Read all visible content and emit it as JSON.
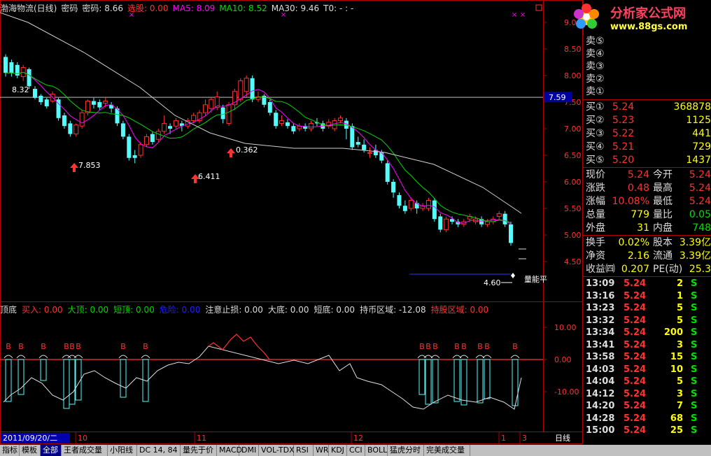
{
  "header": {
    "title": "渤海物流(日线)",
    "pwd_label": "密码",
    "pwd2": "密码: 8.66",
    "xuangu": "选股: 0.00",
    "ma5": "MA5: 8.09",
    "ma10": "MA10: 8.52",
    "ma30": "MA30: 9.46",
    "t0": "T0: - : -"
  },
  "price_axis": [
    "9.00",
    "8.50",
    "8.00",
    "7.50",
    "7.00",
    "6.50",
    "6.00",
    "5.50",
    "5.00",
    "4.50"
  ],
  "current_line_label": "7.59",
  "annotations": {
    "low_label_1": "7.853",
    "low_label_2": "6.411",
    "low_label_3": "0.362",
    "start_label": "8.32",
    "min_label": "4.60",
    "right_label": "量能平"
  },
  "indicator": {
    "name": "顶底",
    "buy": "买入: 0.00",
    "big_top": "大顶: 0.00",
    "short_top": "短顶: 0.00",
    "danger": "危险: 0.00",
    "stop": "注意止损: 0.00",
    "big_bottom": "大底: 0.00",
    "short_bottom": "短底: 0.00",
    "hold_zone": "持币区域: -12.08",
    "hold_stock": "持股区域: 0.00",
    "axis": [
      "10.00",
      "0.00",
      "-10.00"
    ],
    "b_markers": [
      "B",
      "B",
      "B",
      "B",
      "B",
      "B",
      "B",
      "B",
      "B",
      "B",
      "B",
      "B",
      "B",
      "B",
      "B",
      "B",
      "B"
    ]
  },
  "date_axis": {
    "current": "2011/09/20/二",
    "m10": "10",
    "m11": "11",
    "m12": "12",
    "m1": "1",
    "m3": "3",
    "period": "日线"
  },
  "logo": {
    "title": "分析家公式网",
    "url": "www.88gs.com"
  },
  "orderbook": {
    "sell": [
      {
        "label": "卖⑤"
      },
      {
        "label": "卖④"
      },
      {
        "label": "卖③"
      },
      {
        "label": "卖②"
      },
      {
        "label": "卖①"
      }
    ],
    "buy": [
      {
        "label": "买①",
        "price": "5.24",
        "vol": "368878"
      },
      {
        "label": "买②",
        "price": "5.23",
        "vol": "1125"
      },
      {
        "label": "买③",
        "price": "5.22",
        "vol": "441"
      },
      {
        "label": "买④",
        "price": "5.21",
        "vol": "729"
      },
      {
        "label": "买⑤",
        "price": "5.20",
        "vol": "1437"
      }
    ]
  },
  "quote": [
    {
      "l1": "现价",
      "v1": "5.24",
      "l2": "今开",
      "v2": "5.24"
    },
    {
      "l1": "涨跌",
      "v1": "0.48",
      "l2": "最高",
      "v2": "5.24"
    },
    {
      "l1": "涨幅",
      "v1": "10.08%",
      "l2": "最低",
      "v2": "5.24"
    },
    {
      "l1": "总量",
      "v1": "779",
      "l2": "量比",
      "v2": "0.05"
    },
    {
      "l1": "外盘",
      "v1": "31",
      "l2": "内盘",
      "v2": "748"
    }
  ],
  "fundamentals": [
    {
      "l1": "换手",
      "v1": "0.02%",
      "l2": "股本",
      "v2": "3.39亿"
    },
    {
      "l1": "净资",
      "v1": "2.16",
      "l2": "流通",
      "v2": "3.39亿"
    },
    {
      "l1": "收益㈣",
      "v1": "0.207",
      "l2": "PE(动)",
      "v2": "25.3"
    }
  ],
  "ticks": [
    {
      "t": "13:09",
      "p": "5.24",
      "v": "2",
      "s": "S"
    },
    {
      "t": "13:16",
      "p": "5.24",
      "v": "1",
      "s": "S"
    },
    {
      "t": "13:23",
      "p": "5.24",
      "v": "5",
      "s": "S"
    },
    {
      "t": "13:32",
      "p": "5.24",
      "v": "5",
      "s": "S"
    },
    {
      "t": "13:34",
      "p": "5.24",
      "v": "200",
      "s": "S"
    },
    {
      "t": "13:41",
      "p": "5.24",
      "v": "3",
      "s": "S"
    },
    {
      "t": "13:58",
      "p": "5.24",
      "v": "15",
      "s": "S"
    },
    {
      "t": "14:03",
      "p": "5.24",
      "v": "10",
      "s": "S"
    },
    {
      "t": "14:04",
      "p": "5.24",
      "v": "5",
      "s": "S"
    },
    {
      "t": "14:12",
      "p": "5.24",
      "v": "3",
      "s": "S"
    },
    {
      "t": "14:20",
      "p": "5.24",
      "v": "7",
      "s": "S"
    },
    {
      "t": "14:28",
      "p": "5.24",
      "v": "68",
      "s": "S"
    },
    {
      "t": "15:00",
      "p": "5.24",
      "v": "25",
      "s": "S"
    }
  ],
  "tabs": [
    "指标",
    "模板",
    "全部",
    "王者成交量",
    "小阳线",
    "DC 14, 84",
    "量先于价",
    "MACD",
    "DMI",
    "VOL-TDX",
    "RSI",
    "WR",
    "KDJ",
    "CCI",
    "BOLL",
    "猛虎分时",
    "完美成交量"
  ],
  "colors": {
    "red": "#ff3232",
    "cyan": "#54fcfc",
    "yellow": "#ffff00",
    "magenta": "#ff00ff",
    "green": "#00d800"
  }
}
